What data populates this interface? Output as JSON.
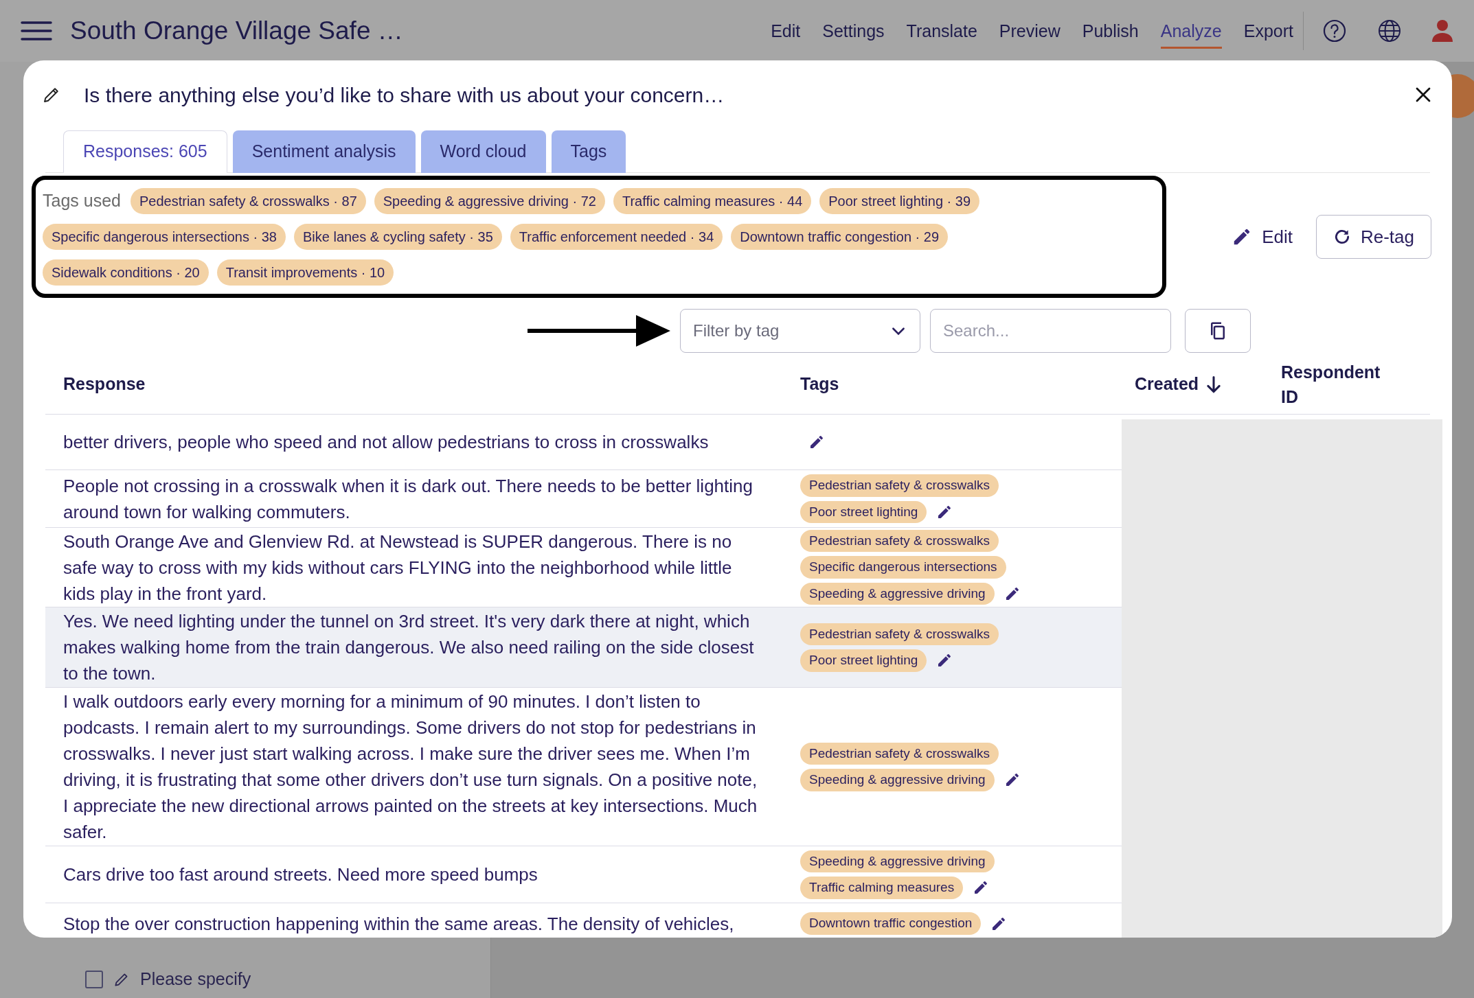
{
  "app_bar": {
    "title": "South Orange Village Safe …",
    "nav": [
      {
        "label": "Edit",
        "selected": false
      },
      {
        "label": "Settings",
        "selected": false
      },
      {
        "label": "Translate",
        "selected": false
      },
      {
        "label": "Preview",
        "selected": false
      },
      {
        "label": "Publish",
        "selected": false
      },
      {
        "label": "Analyze",
        "selected": true
      },
      {
        "label": "Export",
        "selected": false
      }
    ]
  },
  "background": {
    "option": {
      "label": "Please specify",
      "checked": false
    }
  },
  "modal": {
    "title": "Is there anything else you’d like to share with us about your concern…",
    "tabs": [
      {
        "label": "Responses: 605",
        "selected": true
      },
      {
        "label": "Sentiment analysis",
        "selected": false
      },
      {
        "label": "Word cloud",
        "selected": false
      },
      {
        "label": "Tags",
        "selected": false
      }
    ],
    "tags_used": {
      "label": "Tags used",
      "tags": [
        "Pedestrian safety & crosswalks · 87",
        "Speeding & aggressive driving · 72",
        "Traffic calming measures · 44",
        "Poor street lighting · 39",
        "Specific dangerous intersections · 38",
        "Bike lanes & cycling safety · 35",
        "Traffic enforcement needed · 34",
        "Downtown traffic congestion · 29",
        "Sidewalk conditions · 20",
        "Transit improvements · 10"
      ]
    },
    "edit_button": "Edit",
    "retag_button": "Re-tag",
    "filter": {
      "placeholder": "Filter by tag"
    },
    "search": {
      "placeholder": "Search..."
    },
    "table": {
      "columns": [
        {
          "label": "Response",
          "sorted": false
        },
        {
          "label": "Tags",
          "sorted": false
        },
        {
          "label": "Created",
          "sorted": true
        },
        {
          "label": "Respondent ID",
          "sorted": false
        }
      ],
      "rows": [
        {
          "response": "better drivers, people who speed and not allow pedestrians to cross in crosswalks",
          "tags": [],
          "highlighted": false
        },
        {
          "response": "People not crossing in a crosswalk when it is dark out. There needs to be better lighting around town for walking commuters.",
          "tags": [
            "Pedestrian safety & crosswalks",
            "Poor street lighting"
          ],
          "highlighted": false
        },
        {
          "response": "South Orange Ave and Glenview Rd. at Newstead is SUPER dangerous. There is no safe way to cross with my kids without cars FLYING into the neighborhood while little kids play in the front yard.",
          "tags": [
            "Pedestrian safety & crosswalks",
            "Specific dangerous intersections",
            "Speeding & aggressive driving"
          ],
          "highlighted": false
        },
        {
          "response": "Yes. We need lighting under the tunnel on 3rd street. It's very dark there at night, which makes walking home from the train dangerous. We also need railing on the side closest to the town.",
          "tags": [
            "Pedestrian safety & crosswalks",
            "Poor street lighting"
          ],
          "highlighted": true
        },
        {
          "response": "I walk outdoors early every morning for a minimum of 90 minutes. I don’t listen to podcasts. I remain alert to my surroundings. Some drivers do not stop for pedestrians in crosswalks. I never just start walking across. I make sure the driver sees me. When I’m driving, it is frustrating that some other drivers don’t use turn signals. On a positive note, I appreciate the new directional arrows painted on the streets at key intersections. Much safer.",
          "tags": [
            "Pedestrian safety & crosswalks",
            "Speeding & aggressive driving"
          ],
          "highlighted": false
        },
        {
          "response": "Cars drive too fast around streets. Need more speed bumps",
          "tags": [
            "Speeding & aggressive driving",
            "Traffic calming measures"
          ],
          "highlighted": false
        },
        {
          "response": "Stop the over construction happening within the same areas. The density of vehicles,",
          "tags": [
            "Downtown traffic congestion"
          ],
          "highlighted": false
        }
      ]
    }
  }
}
